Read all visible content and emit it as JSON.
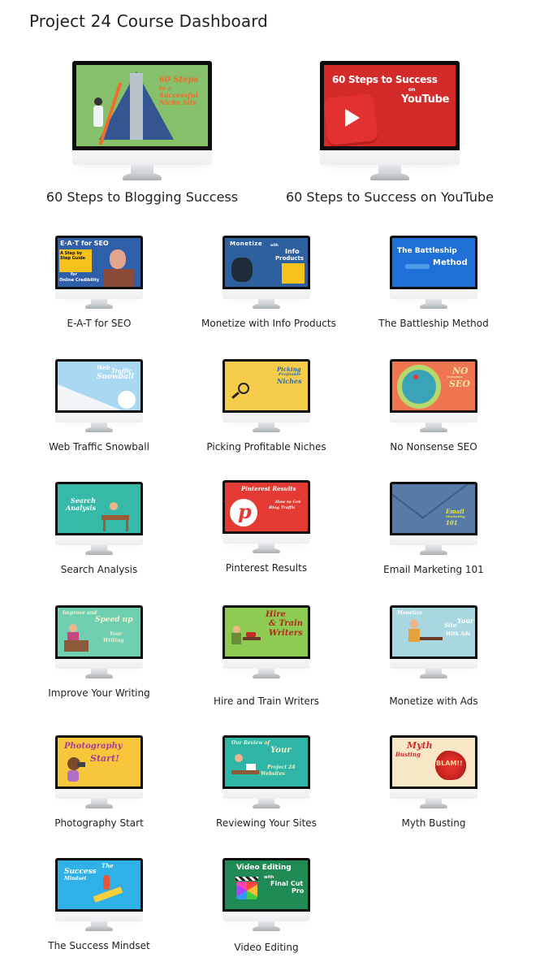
{
  "page": {
    "title": "Project 24 Course Dashboard"
  },
  "featured_courses": [
    {
      "label": "60 Steps to Blogging Success",
      "thumbnail": {
        "bg": "#86c06a",
        "accent": "#f26b2a",
        "lines": [
          "60 Steps",
          "to a",
          "Successful",
          "Niche Site"
        ]
      }
    },
    {
      "label": "60 Steps to Success on YouTube",
      "thumbnail": {
        "bg": "#d42a2a",
        "accent": "#ffffff",
        "lines": [
          "60 Steps to Success",
          "on",
          "YouTube"
        ]
      }
    }
  ],
  "courses": [
    {
      "label": "E-A-T for SEO",
      "thumbnail": {
        "bg": "#2f5fa8",
        "lines": [
          "E·A·T for SEO",
          "A Step by Step Guide",
          "for",
          "Online Credibility"
        ]
      }
    },
    {
      "label": "Monetize with Info Products",
      "thumbnail": {
        "bg": "#2e5f9e",
        "lines": [
          "Monetize",
          "with",
          "Info",
          "Products"
        ]
      }
    },
    {
      "label": "The Battleship Method",
      "thumbnail": {
        "bg": "#1e6fd6",
        "lines": [
          "The Battleship",
          "Method"
        ]
      }
    },
    {
      "label": "Web Traffic Snowball",
      "thumbnail": {
        "bg": "#a9d8f3",
        "lines": [
          "Web",
          "Traffic",
          "Snowball"
        ]
      }
    },
    {
      "label": "Picking Profitable Niches",
      "thumbnail": {
        "bg": "#f6cd4a",
        "lines": [
          "Picking",
          "Profitable",
          "Niches"
        ]
      }
    },
    {
      "label": "No Nonsense SEO",
      "thumbnail": {
        "bg": "#ef7650",
        "lines": [
          "NO",
          "NONSENSE",
          "SEO"
        ]
      }
    },
    {
      "label": "Search Analysis",
      "thumbnail": {
        "bg": "#36b9a6",
        "lines": [
          "Search",
          "Analysis"
        ]
      }
    },
    {
      "label": "Pinterest Results",
      "thumbnail": {
        "bg": "#e33a33",
        "lines": [
          "Pinterest Results",
          "How to Get",
          "Blog Traffic"
        ]
      }
    },
    {
      "label": "Email Marketing 101",
      "thumbnail": {
        "bg": "#577aa6",
        "lines": [
          "Email",
          "Marketing",
          "101"
        ]
      }
    },
    {
      "label": "Improve Your Writing",
      "thumbnail": {
        "bg": "#6ecfb1",
        "lines": [
          "Improve and",
          "Speed up",
          "Your",
          "Writing"
        ]
      }
    },
    {
      "label": "Hire and Train Writers",
      "thumbnail": {
        "bg": "#8ecb52",
        "lines": [
          "Hire",
          "& Train",
          "Writers"
        ]
      }
    },
    {
      "label": "Monetize with Ads",
      "thumbnail": {
        "bg": "#a9d7e0",
        "lines": [
          "Monetize",
          "Your",
          "Site",
          "With Ads"
        ]
      }
    },
    {
      "label": "Photography Start",
      "thumbnail": {
        "bg": "#f7c63b",
        "lines": [
          "Photography",
          "Start!"
        ]
      }
    },
    {
      "label": "Reviewing Your Sites",
      "thumbnail": {
        "bg": "#2fb5a6",
        "lines": [
          "Our Review of",
          "Your",
          "Project 24",
          "Websites"
        ]
      }
    },
    {
      "label": "Myth Busting",
      "thumbnail": {
        "bg": "#f7e7c6",
        "lines": [
          "Myth",
          "Busting",
          "BLAM!!"
        ]
      }
    },
    {
      "label": "The Success Mindset",
      "thumbnail": {
        "bg": "#2fb0e6",
        "lines": [
          "The",
          "Success",
          "Mindset"
        ]
      }
    },
    {
      "label": "Video Editing",
      "thumbnail": {
        "bg": "#1f8a53",
        "lines": [
          "Video Editing",
          "with",
          "Final Cut",
          "Pro"
        ]
      }
    }
  ]
}
